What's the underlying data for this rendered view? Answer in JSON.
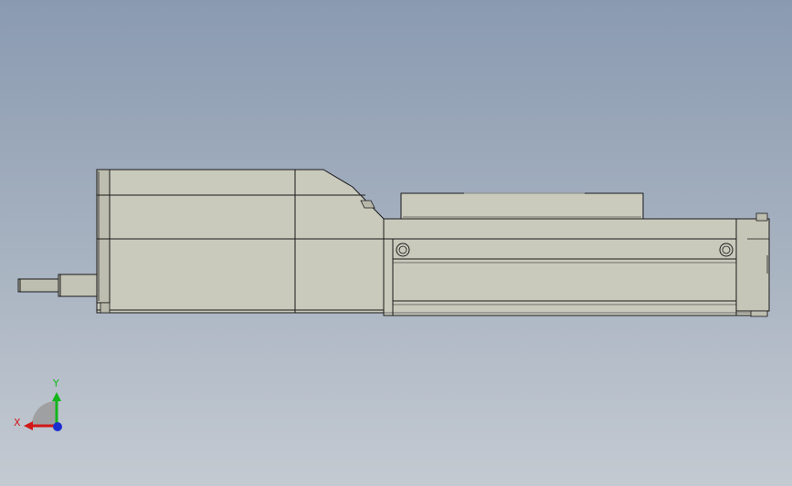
{
  "viewport": {
    "background_top": "#8a9ab1",
    "background_bottom": "#c4cad2"
  },
  "model": {
    "body_color": "#c9c9bc",
    "body_shadow_color": "#b8b8aa",
    "edge_color": "#1a1a1a",
    "cable_color": "#bdbdb0"
  },
  "triad": {
    "x_label": "X",
    "y_label": "Y",
    "x_color": "#d01818",
    "y_color": "#12b51a",
    "z_color": "#1a2fd0"
  }
}
